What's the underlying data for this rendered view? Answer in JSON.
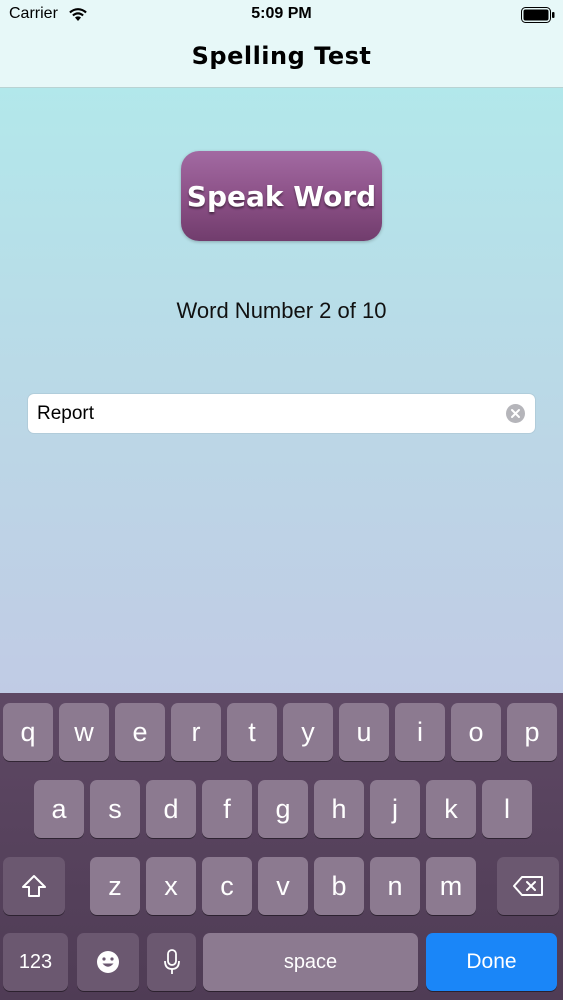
{
  "status_bar": {
    "carrier": "Carrier",
    "time": "5:09 PM"
  },
  "nav": {
    "title": "Spelling Test"
  },
  "speak_button": {
    "label": "Speak Word"
  },
  "progress": {
    "text": "Word Number 2 of 10"
  },
  "answer_field": {
    "value": "Report"
  },
  "keyboard": {
    "row1": [
      "q",
      "w",
      "e",
      "r",
      "t",
      "y",
      "u",
      "i",
      "o",
      "p"
    ],
    "row2": [
      "a",
      "s",
      "d",
      "f",
      "g",
      "h",
      "j",
      "k",
      "l"
    ],
    "row3": [
      "z",
      "x",
      "c",
      "v",
      "b",
      "n",
      "m"
    ],
    "numbers_label": "123",
    "space_label": "space",
    "done_label": "Done"
  },
  "colors": {
    "button_purple": "#8a4f85",
    "done_blue": "#1a86f8",
    "keyboard_bg": "#5e4864"
  }
}
